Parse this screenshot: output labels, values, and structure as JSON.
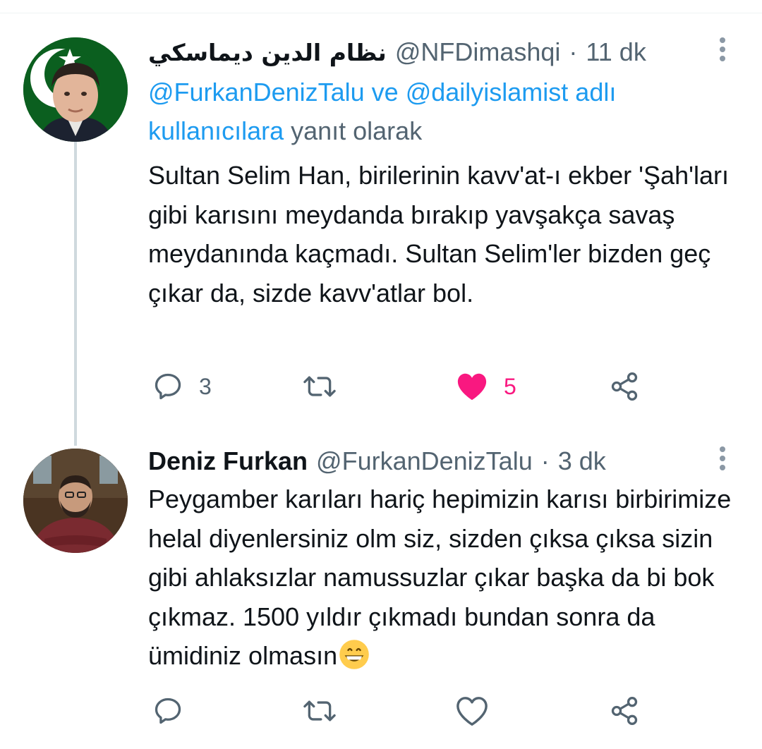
{
  "tweets": [
    {
      "author_name": "نظام الدين ديماسكي",
      "handle": "@NFDimashqi",
      "separator": "·",
      "time": "11 dk",
      "reply_to": {
        "mention1": "@FurkanDenizTalu",
        "connector": " ve ",
        "mention2": "@dailyislamist adlı kullanıcılara",
        "suffix": " yanıt olarak"
      },
      "text": "Sultan Selim Han, birilerinin kavv'at-ı ekber 'Şah'ları gibi karısını meydanda bırakıp yavşakça savaş meydanında kaçmadı. Sultan Selim'ler bizden geç çıkar da, sizde kavv'atlar bol.",
      "reply_count": "3",
      "retweet_count": "",
      "like_count": "5",
      "liked": true
    },
    {
      "author_name": "Deniz Furkan",
      "handle": "@FurkanDenizTalu",
      "separator": "·",
      "time": "3 dk",
      "text": "Peygamber karıları hariç hepimizin karısı birbirimize helal diyenlersiniz olm siz, sizden çıksa çıksa sizin gibi ahlaksızlar namussuzlar çıkar başka da bi bok çıkmaz. 1500 yıldır çıkmadı bundan sonra da ümidiniz olmasın",
      "reply_count": "",
      "retweet_count": "",
      "like_count": "",
      "liked": false
    }
  ],
  "icons": {
    "more": "more-vertical-icon",
    "reply": "speech-bubble-icon",
    "retweet": "retweet-arrows-icon",
    "like": "heart-icon",
    "share": "share-nodes-icon",
    "emoji": "grinning-face-emoji"
  },
  "colors": {
    "link": "#1d9bf0",
    "secondary_text": "#536471",
    "like_active": "#f91880",
    "thread_line": "#cfd9de"
  }
}
